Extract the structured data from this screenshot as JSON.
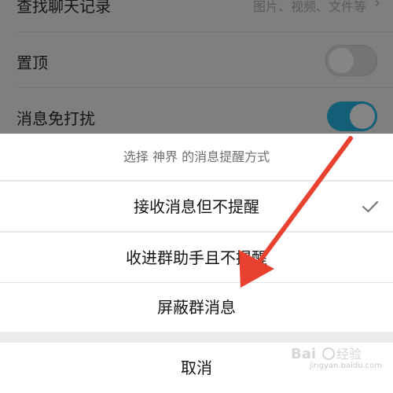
{
  "settings": {
    "search_history": {
      "label": "查找聊天记录",
      "hint": "图片、视频、文件等"
    },
    "pin_top": {
      "label": "置顶",
      "enabled": false
    },
    "do_not_disturb": {
      "label": "消息免打扰",
      "enabled": true
    }
  },
  "sheet": {
    "title": "选择 神界 的消息提醒方式",
    "options": [
      {
        "label": "接收消息但不提醒",
        "selected": true
      },
      {
        "label": "收进群助手且不提醒",
        "selected": false
      },
      {
        "label": "屏蔽群消息",
        "selected": false
      }
    ],
    "cancel_label": "取消"
  },
  "colors": {
    "toggle_on": "#1a9ad0",
    "arrow": "#e8412f",
    "check": "#777777"
  },
  "watermark": {
    "text": "jingyan.baidu.com"
  }
}
